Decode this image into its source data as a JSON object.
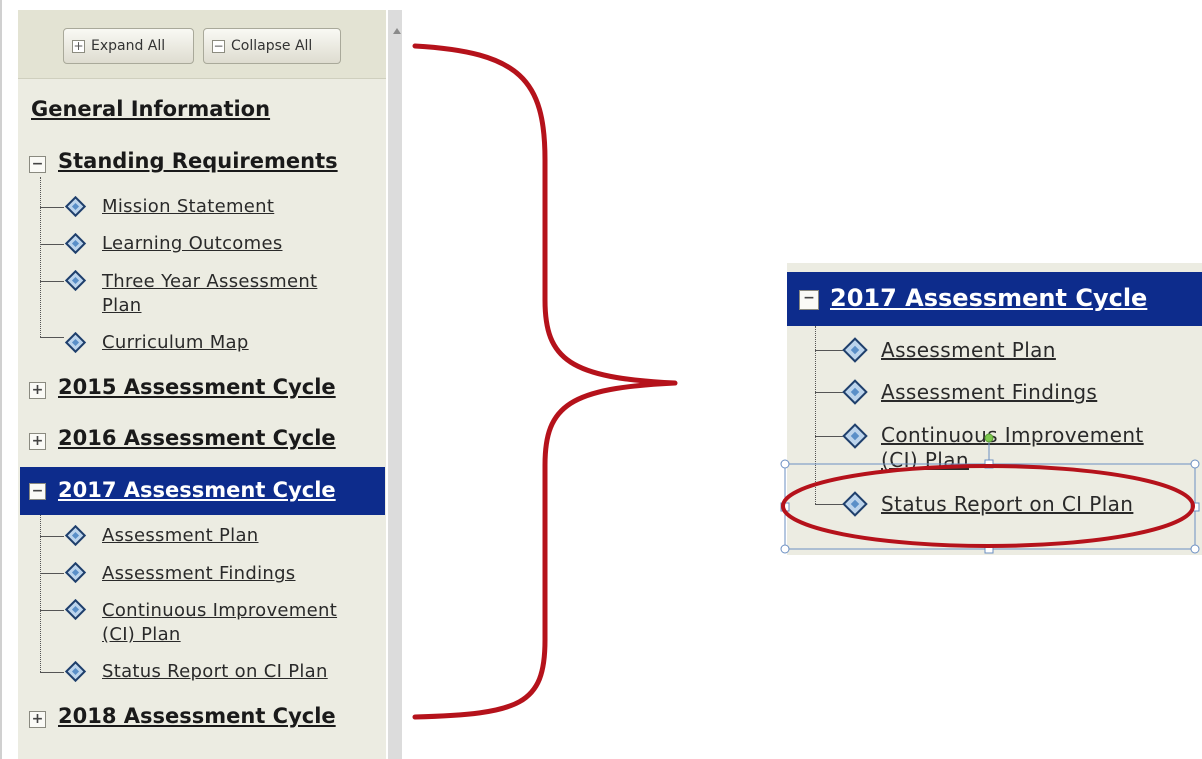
{
  "toolbar": {
    "expand_all": "Expand All",
    "collapse_all": "Collapse All",
    "plus_glyph": "+",
    "minus_glyph": "−"
  },
  "tree": {
    "general_information": "General Information",
    "standing_requirements": {
      "label": "Standing Requirements",
      "expanded": true,
      "items": [
        "Mission Statement",
        "Learning Outcomes",
        "Three Year Assessment",
        "Plan",
        "Curriculum Map"
      ]
    },
    "cycle_2015": {
      "label": "2015 Assessment Cycle",
      "expanded": false
    },
    "cycle_2016": {
      "label": "2016 Assessment Cycle",
      "expanded": false
    },
    "cycle_2017": {
      "label": "2017 Assessment Cycle",
      "expanded": true,
      "selected": true,
      "items": [
        "Assessment Plan",
        "Assessment Findings",
        "Continuous Improvement",
        "(CI) Plan",
        "Status Report on CI Plan"
      ]
    },
    "cycle_2018": {
      "label": "2018 Assessment Cycle",
      "expanded": false
    }
  },
  "zoom": {
    "header": "2017 Assessment Cycle",
    "items": [
      "Assessment Plan",
      "Assessment Findings",
      "Continuous Improvement",
      "(CI) Plan",
      "Status Report on CI Plan"
    ]
  },
  "colors": {
    "panel_bg": "#ecece2",
    "selected_bg": "#0d2c8c",
    "annotation_red": "#b5121b",
    "leaf_icon": "#5a8fc8"
  },
  "icons": {
    "expand": "plus-box-icon",
    "collapse": "minus-box-icon",
    "leaf": "diamond-page-icon",
    "annotation": "curly-brace-annotation"
  }
}
